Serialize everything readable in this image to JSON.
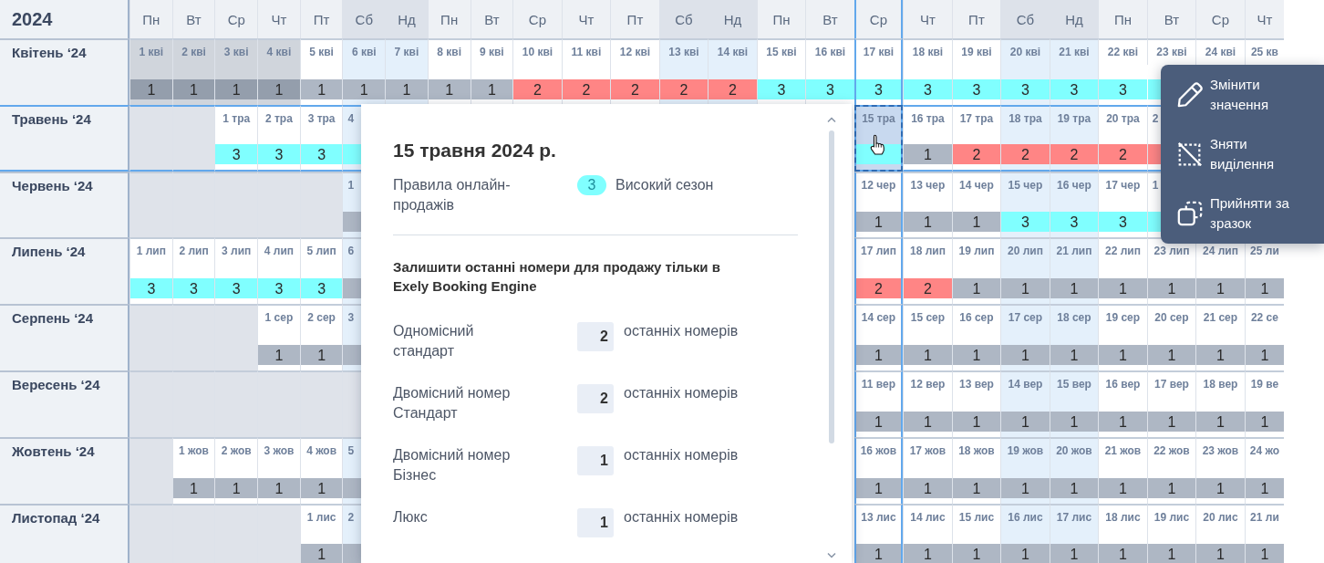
{
  "calendar": {
    "year": "2024",
    "weekdays": [
      {
        "label": "Пн",
        "weekend": false,
        "highlighted": false
      },
      {
        "label": "Вт",
        "weekend": false,
        "highlighted": false
      },
      {
        "label": "Ср",
        "weekend": false,
        "highlighted": false
      },
      {
        "label": "Чт",
        "weekend": false,
        "highlighted": false
      },
      {
        "label": "Пт",
        "weekend": false,
        "highlighted": false
      },
      {
        "label": "Сб",
        "weekend": true,
        "highlighted": false
      },
      {
        "label": "Нд",
        "weekend": true,
        "highlighted": false
      },
      {
        "label": "Пн",
        "weekend": false,
        "highlighted": false
      },
      {
        "label": "Вт",
        "weekend": false,
        "highlighted": false
      },
      {
        "label": "Ср",
        "weekend": false,
        "highlighted": false
      },
      {
        "label": "Чт",
        "weekend": false,
        "highlighted": false
      },
      {
        "label": "Пт",
        "weekend": false,
        "highlighted": false
      },
      {
        "label": "Сб",
        "weekend": true,
        "highlighted": false
      },
      {
        "label": "Нд",
        "weekend": true,
        "highlighted": false
      },
      {
        "label": "Пн",
        "weekend": false,
        "highlighted": false
      },
      {
        "label": "Вт",
        "weekend": false,
        "highlighted": false
      },
      {
        "label": "Ср",
        "weekend": false,
        "highlighted": true
      },
      {
        "label": "Чт",
        "weekend": false,
        "highlighted": false
      },
      {
        "label": "Пт",
        "weekend": false,
        "highlighted": false
      },
      {
        "label": "Сб",
        "weekend": true,
        "highlighted": false
      },
      {
        "label": "Нд",
        "weekend": true,
        "highlighted": false
      },
      {
        "label": "Пн",
        "weekend": false,
        "highlighted": false
      },
      {
        "label": "Вт",
        "weekend": false,
        "highlighted": false
      },
      {
        "label": "Ср",
        "weekend": false,
        "highlighted": false
      },
      {
        "label": "Чт",
        "weekend": false,
        "highlighted": false
      }
    ],
    "months": [
      {
        "label": "Квітень ‘24",
        "highlighted": false,
        "days": [
          {
            "kind": "past",
            "date": "1 кві",
            "value": "1",
            "color": "#949eac",
            "selected": false
          },
          {
            "kind": "past",
            "date": "2 кві",
            "value": "1",
            "color": "#949eac",
            "selected": false
          },
          {
            "kind": "past",
            "date": "3 кві",
            "value": "1",
            "color": "#949eac",
            "selected": false
          },
          {
            "kind": "past",
            "date": "4 кві",
            "value": "1",
            "color": "#949eac",
            "selected": false
          },
          {
            "kind": "day",
            "date": "5 кві",
            "value": "1",
            "color": "#aeb7c4",
            "selected": false
          },
          {
            "kind": "day",
            "date": "6 кві",
            "value": "1",
            "color": "#aeb7c4",
            "selected": false
          },
          {
            "kind": "day",
            "date": "7 кві",
            "value": "1",
            "color": "#aeb7c4",
            "selected": false
          },
          {
            "kind": "day",
            "date": "8 кві",
            "value": "1",
            "color": "#aeb7c4",
            "selected": false
          },
          {
            "kind": "day",
            "date": "9 кві",
            "value": "1",
            "color": "#aeb7c4",
            "selected": false
          },
          {
            "kind": "day",
            "date": "10 кві",
            "value": "2",
            "color": "#ff8585",
            "selected": false
          },
          {
            "kind": "day",
            "date": "11 кві",
            "value": "2",
            "color": "#ff8585",
            "selected": false
          },
          {
            "kind": "day",
            "date": "12 кві",
            "value": "2",
            "color": "#ff8585",
            "selected": false
          },
          {
            "kind": "day",
            "date": "13 кві",
            "value": "2",
            "color": "#ff8585",
            "selected": false
          },
          {
            "kind": "day",
            "date": "14 кві",
            "value": "2",
            "color": "#ff8585",
            "selected": false
          },
          {
            "kind": "day",
            "date": "15 кві",
            "value": "3",
            "color": "#80ffff",
            "selected": false
          },
          {
            "kind": "day",
            "date": "16 кві",
            "value": "3",
            "color": "#80ffff",
            "selected": false
          },
          {
            "kind": "day",
            "date": "17 кві",
            "value": "3",
            "color": "#80ffff",
            "selected": false
          },
          {
            "kind": "day",
            "date": "18 кві",
            "value": "3",
            "color": "#80ffff",
            "selected": false
          },
          {
            "kind": "day",
            "date": "19 кві",
            "value": "3",
            "color": "#80ffff",
            "selected": false
          },
          {
            "kind": "day",
            "date": "20 кві",
            "value": "3",
            "color": "#80ffff",
            "selected": false
          },
          {
            "kind": "day",
            "date": "21 кві",
            "value": "3",
            "color": "#80ffff",
            "selected": false
          },
          {
            "kind": "day",
            "date": "22 кві",
            "value": "3",
            "color": "#80ffff",
            "selected": false
          },
          {
            "kind": "day",
            "date": "23 кві",
            "color": "#80ffff",
            "selected": false
          },
          {
            "kind": "day",
            "date": "24 кві",
            "selected": false
          },
          {
            "kind": "day",
            "date": "25 кв",
            "selected": false
          }
        ]
      },
      {
        "label": "Травень ‘24",
        "highlighted": true,
        "days": [
          {
            "kind": "blank"
          },
          {
            "kind": "blank"
          },
          {
            "kind": "day",
            "date": "1 тра",
            "value": "3",
            "color": "#80ffff",
            "selected": false
          },
          {
            "kind": "day",
            "date": "2 тра",
            "value": "3",
            "color": "#80ffff",
            "selected": false
          },
          {
            "kind": "day",
            "date": "3 тра",
            "value": "3",
            "color": "#80ffff",
            "selected": false
          },
          {
            "kind": "cut",
            "date": "4",
            "color": "#80ffff",
            "selected": false
          },
          {
            "kind": "covered"
          },
          {
            "kind": "covered"
          },
          {
            "kind": "covered"
          },
          {
            "kind": "covered"
          },
          {
            "kind": "covered"
          },
          {
            "kind": "covered"
          },
          {
            "kind": "covered"
          },
          {
            "kind": "covered"
          },
          {
            "kind": "covered"
          },
          {
            "kind": "covered"
          },
          {
            "kind": "day",
            "date": "15 тра",
            "color": "#80ffff",
            "selected": true
          },
          {
            "kind": "day",
            "date": "16 тра",
            "value": "1",
            "color": "#aeb7c4",
            "selected": false
          },
          {
            "kind": "day",
            "date": "17 тра",
            "value": "2",
            "color": "#ff8585",
            "selected": false
          },
          {
            "kind": "day",
            "date": "18 тра",
            "value": "2",
            "color": "#ff8585",
            "selected": false
          },
          {
            "kind": "day",
            "date": "19 тра",
            "value": "2",
            "color": "#ff8585",
            "selected": false
          },
          {
            "kind": "day",
            "date": "20 тра",
            "value": "2",
            "color": "#ff8585",
            "selected": false
          },
          {
            "kind": "cut",
            "date": "2",
            "color": "#ff8585",
            "selected": false
          },
          {
            "kind": "covered"
          },
          {
            "kind": "covered"
          }
        ]
      },
      {
        "label": "Червень ‘24",
        "highlighted": false,
        "days": [
          {
            "kind": "blank"
          },
          {
            "kind": "blank"
          },
          {
            "kind": "blank"
          },
          {
            "kind": "blank"
          },
          {
            "kind": "blank"
          },
          {
            "kind": "cut",
            "date": "1",
            "color": "#aeb7c4",
            "selected": false
          },
          {
            "kind": "covered"
          },
          {
            "kind": "covered"
          },
          {
            "kind": "covered"
          },
          {
            "kind": "covered"
          },
          {
            "kind": "covered"
          },
          {
            "kind": "covered"
          },
          {
            "kind": "covered"
          },
          {
            "kind": "covered"
          },
          {
            "kind": "covered"
          },
          {
            "kind": "covered"
          },
          {
            "kind": "day",
            "date": "12 чер",
            "value": "1",
            "color": "#aeb7c4",
            "selected": false
          },
          {
            "kind": "day",
            "date": "13 чер",
            "value": "1",
            "color": "#aeb7c4",
            "selected": false
          },
          {
            "kind": "day",
            "date": "14 чер",
            "value": "1",
            "color": "#aeb7c4",
            "selected": false
          },
          {
            "kind": "day",
            "date": "15 чер",
            "value": "3",
            "color": "#80ffff",
            "selected": false
          },
          {
            "kind": "day",
            "date": "16 чер",
            "value": "3",
            "color": "#80ffff",
            "selected": false
          },
          {
            "kind": "day",
            "date": "17 чер",
            "value": "3",
            "color": "#80ffff",
            "selected": false
          },
          {
            "kind": "cut",
            "date": "1",
            "color": "#80ffff",
            "selected": false
          },
          {
            "kind": "covered"
          },
          {
            "kind": "covered"
          }
        ]
      },
      {
        "label": "Липень ‘24",
        "highlighted": false,
        "days": [
          {
            "kind": "day",
            "date": "1 лип",
            "value": "3",
            "color": "#80ffff",
            "selected": false
          },
          {
            "kind": "day",
            "date": "2 лип",
            "value": "3",
            "color": "#80ffff",
            "selected": false
          },
          {
            "kind": "day",
            "date": "3 лип",
            "value": "3",
            "color": "#80ffff",
            "selected": false
          },
          {
            "kind": "day",
            "date": "4 лип",
            "value": "3",
            "color": "#80ffff",
            "selected": false
          },
          {
            "kind": "day",
            "date": "5 лип",
            "value": "3",
            "color": "#80ffff",
            "selected": false
          },
          {
            "kind": "cut",
            "date": "6",
            "color": "#aeb7c4",
            "selected": false
          },
          {
            "kind": "covered"
          },
          {
            "kind": "covered"
          },
          {
            "kind": "covered"
          },
          {
            "kind": "covered"
          },
          {
            "kind": "covered"
          },
          {
            "kind": "covered"
          },
          {
            "kind": "covered"
          },
          {
            "kind": "covered"
          },
          {
            "kind": "covered"
          },
          {
            "kind": "covered"
          },
          {
            "kind": "day",
            "date": "17 лип",
            "value": "2",
            "color": "#ff8585",
            "selected": false
          },
          {
            "kind": "day",
            "date": "18 лип",
            "value": "2",
            "color": "#ff8585",
            "selected": false
          },
          {
            "kind": "day",
            "date": "19 лип",
            "value": "1",
            "color": "#aeb7c4",
            "selected": false
          },
          {
            "kind": "day",
            "date": "20 лип",
            "value": "1",
            "color": "#aeb7c4",
            "selected": false
          },
          {
            "kind": "day",
            "date": "21 лип",
            "value": "1",
            "color": "#aeb7c4",
            "selected": false
          },
          {
            "kind": "day",
            "date": "22 лип",
            "value": "1",
            "color": "#aeb7c4",
            "selected": false
          },
          {
            "kind": "day",
            "date": "23 лип",
            "value": "1",
            "color": "#aeb7c4",
            "selected": false
          },
          {
            "kind": "day",
            "date": "24 лип",
            "value": "1",
            "color": "#aeb7c4",
            "selected": false
          },
          {
            "kind": "day",
            "date": "25 ли",
            "value": "1",
            "color": "#aeb7c4",
            "selected": false
          }
        ]
      },
      {
        "label": "Серпень ‘24",
        "highlighted": false,
        "days": [
          {
            "kind": "blank"
          },
          {
            "kind": "blank"
          },
          {
            "kind": "blank"
          },
          {
            "kind": "day",
            "date": "1 сер",
            "value": "1",
            "color": "#aeb7c4",
            "selected": false
          },
          {
            "kind": "day",
            "date": "2 сер",
            "value": "1",
            "color": "#aeb7c4",
            "selected": false
          },
          {
            "kind": "cut",
            "date": "3",
            "color": "#aeb7c4",
            "selected": false
          },
          {
            "kind": "covered"
          },
          {
            "kind": "covered"
          },
          {
            "kind": "covered"
          },
          {
            "kind": "covered"
          },
          {
            "kind": "covered"
          },
          {
            "kind": "covered"
          },
          {
            "kind": "covered"
          },
          {
            "kind": "covered"
          },
          {
            "kind": "covered"
          },
          {
            "kind": "covered"
          },
          {
            "kind": "day",
            "date": "14 сер",
            "value": "1",
            "color": "#aeb7c4",
            "selected": false
          },
          {
            "kind": "day",
            "date": "15 сер",
            "value": "1",
            "color": "#aeb7c4",
            "selected": false
          },
          {
            "kind": "day",
            "date": "16 сер",
            "value": "1",
            "color": "#aeb7c4",
            "selected": false
          },
          {
            "kind": "day",
            "date": "17 сер",
            "value": "1",
            "color": "#aeb7c4",
            "selected": false
          },
          {
            "kind": "day",
            "date": "18 сер",
            "value": "1",
            "color": "#aeb7c4",
            "selected": false
          },
          {
            "kind": "day",
            "date": "19 сер",
            "value": "1",
            "color": "#aeb7c4",
            "selected": false
          },
          {
            "kind": "day",
            "date": "20 сер",
            "value": "1",
            "color": "#aeb7c4",
            "selected": false
          },
          {
            "kind": "day",
            "date": "21 сер",
            "value": "1",
            "color": "#aeb7c4",
            "selected": false
          },
          {
            "kind": "day",
            "date": "22 се",
            "value": "1",
            "color": "#aeb7c4",
            "selected": false
          }
        ]
      },
      {
        "label": "Вересень ‘24",
        "highlighted": false,
        "days": [
          {
            "kind": "blank"
          },
          {
            "kind": "blank"
          },
          {
            "kind": "blank"
          },
          {
            "kind": "blank"
          },
          {
            "kind": "blank"
          },
          {
            "kind": "blank"
          },
          {
            "kind": "covered"
          },
          {
            "kind": "covered"
          },
          {
            "kind": "covered"
          },
          {
            "kind": "covered"
          },
          {
            "kind": "covered"
          },
          {
            "kind": "covered"
          },
          {
            "kind": "covered"
          },
          {
            "kind": "covered"
          },
          {
            "kind": "covered"
          },
          {
            "kind": "covered"
          },
          {
            "kind": "day",
            "date": "11 вер",
            "value": "1",
            "color": "#aeb7c4",
            "selected": false
          },
          {
            "kind": "day",
            "date": "12 вер",
            "value": "1",
            "color": "#aeb7c4",
            "selected": false
          },
          {
            "kind": "day",
            "date": "13 вер",
            "value": "1",
            "color": "#aeb7c4",
            "selected": false
          },
          {
            "kind": "day",
            "date": "14 вер",
            "value": "1",
            "color": "#aeb7c4",
            "selected": false
          },
          {
            "kind": "day",
            "date": "15 вер",
            "value": "1",
            "color": "#aeb7c4",
            "selected": false
          },
          {
            "kind": "day",
            "date": "16 вер",
            "value": "1",
            "color": "#aeb7c4",
            "selected": false
          },
          {
            "kind": "day",
            "date": "17 вер",
            "value": "1",
            "color": "#aeb7c4",
            "selected": false
          },
          {
            "kind": "day",
            "date": "18 вер",
            "value": "1",
            "color": "#aeb7c4",
            "selected": false
          },
          {
            "kind": "day",
            "date": "19 ве",
            "value": "1",
            "color": "#aeb7c4",
            "selected": false
          }
        ]
      },
      {
        "label": "Жовтень ‘24",
        "highlighted": false,
        "days": [
          {
            "kind": "blank"
          },
          {
            "kind": "day",
            "date": "1 жов",
            "value": "1",
            "color": "#aeb7c4",
            "selected": false
          },
          {
            "kind": "day",
            "date": "2 жов",
            "value": "1",
            "color": "#aeb7c4",
            "selected": false
          },
          {
            "kind": "day",
            "date": "3 жов",
            "value": "1",
            "color": "#aeb7c4",
            "selected": false
          },
          {
            "kind": "day",
            "date": "4 жов",
            "value": "1",
            "color": "#aeb7c4",
            "selected": false
          },
          {
            "kind": "cut",
            "date": "5",
            "color": "#aeb7c4",
            "selected": false
          },
          {
            "kind": "covered"
          },
          {
            "kind": "covered"
          },
          {
            "kind": "covered"
          },
          {
            "kind": "covered"
          },
          {
            "kind": "covered"
          },
          {
            "kind": "covered"
          },
          {
            "kind": "covered"
          },
          {
            "kind": "covered"
          },
          {
            "kind": "covered"
          },
          {
            "kind": "covered"
          },
          {
            "kind": "day",
            "date": "16 жов",
            "value": "1",
            "color": "#aeb7c4",
            "selected": false
          },
          {
            "kind": "day",
            "date": "17 жов",
            "value": "1",
            "color": "#aeb7c4",
            "selected": false
          },
          {
            "kind": "day",
            "date": "18 жов",
            "value": "1",
            "color": "#aeb7c4",
            "selected": false
          },
          {
            "kind": "day",
            "date": "19 жов",
            "value": "1",
            "color": "#aeb7c4",
            "selected": false
          },
          {
            "kind": "day",
            "date": "20 жов",
            "value": "1",
            "color": "#aeb7c4",
            "selected": false
          },
          {
            "kind": "day",
            "date": "21 жов",
            "value": "1",
            "color": "#aeb7c4",
            "selected": false
          },
          {
            "kind": "day",
            "date": "22 жов",
            "value": "1",
            "color": "#aeb7c4",
            "selected": false
          },
          {
            "kind": "day",
            "date": "23 жов",
            "value": "1",
            "color": "#aeb7c4",
            "selected": false
          },
          {
            "kind": "day",
            "date": "24 жо",
            "value": "1",
            "color": "#aeb7c4",
            "selected": false
          }
        ]
      },
      {
        "label": "Листопад ‘24",
        "highlighted": false,
        "days": [
          {
            "kind": "blank"
          },
          {
            "kind": "blank"
          },
          {
            "kind": "blank"
          },
          {
            "kind": "blank"
          },
          {
            "kind": "day",
            "date": "1 лис",
            "value": "1",
            "color": "#aeb7c4",
            "selected": false
          },
          {
            "kind": "cut",
            "date": "2",
            "color": "#aeb7c4",
            "selected": false
          },
          {
            "kind": "covered"
          },
          {
            "kind": "covered"
          },
          {
            "kind": "covered"
          },
          {
            "kind": "covered"
          },
          {
            "kind": "covered"
          },
          {
            "kind": "covered"
          },
          {
            "kind": "covered"
          },
          {
            "kind": "covered"
          },
          {
            "kind": "covered"
          },
          {
            "kind": "covered"
          },
          {
            "kind": "day",
            "date": "13 лис",
            "value": "1",
            "color": "#aeb7c4",
            "selected": false
          },
          {
            "kind": "day",
            "date": "14 лис",
            "value": "1",
            "color": "#aeb7c4",
            "selected": false
          },
          {
            "kind": "day",
            "date": "15 лис",
            "value": "1",
            "color": "#aeb7c4",
            "selected": false
          },
          {
            "kind": "day",
            "date": "16 лис",
            "value": "1",
            "color": "#aeb7c4",
            "selected": false
          },
          {
            "kind": "day",
            "date": "17 лис",
            "value": "1",
            "color": "#aeb7c4",
            "selected": false
          },
          {
            "kind": "day",
            "date": "18 лис",
            "value": "1",
            "color": "#aeb7c4",
            "selected": false
          },
          {
            "kind": "day",
            "date": "19 лис",
            "value": "1",
            "color": "#aeb7c4",
            "selected": false
          },
          {
            "kind": "day",
            "date": "20 лис",
            "value": "1",
            "color": "#aeb7c4",
            "selected": false
          },
          {
            "kind": "day",
            "date": "21 ли",
            "value": "1",
            "color": "#aeb7c4",
            "selected": false
          }
        ]
      }
    ]
  },
  "day_popup": {
    "title": "15 травня 2024 р.",
    "rule": {
      "label": "Правила онлайн-продажів",
      "badge": "3",
      "color": "#80ffff",
      "name": "Високий сезон"
    },
    "heading": "Залишити останні номери для продажу тільки в Exely Booking Engine",
    "rooms": [
      {
        "name": "Одномісний стандарт",
        "value": "2",
        "unit": "останніх номерів"
      },
      {
        "name": "Двомісний номер Стандарт",
        "value": "2",
        "unit": "останніх номерів"
      },
      {
        "name": "Двомісний номер Бізнес",
        "value": "1",
        "unit": "останніх номерів"
      },
      {
        "name": "Люкс",
        "value": "1",
        "unit": "останніх номерів"
      }
    ]
  },
  "context_menu": {
    "items": [
      {
        "kind": "edit",
        "label": "Змінити значення"
      },
      {
        "kind": "deselect",
        "label": "Зняти виділення"
      },
      {
        "kind": "sample",
        "label": "Прийняти за зразок"
      }
    ]
  }
}
